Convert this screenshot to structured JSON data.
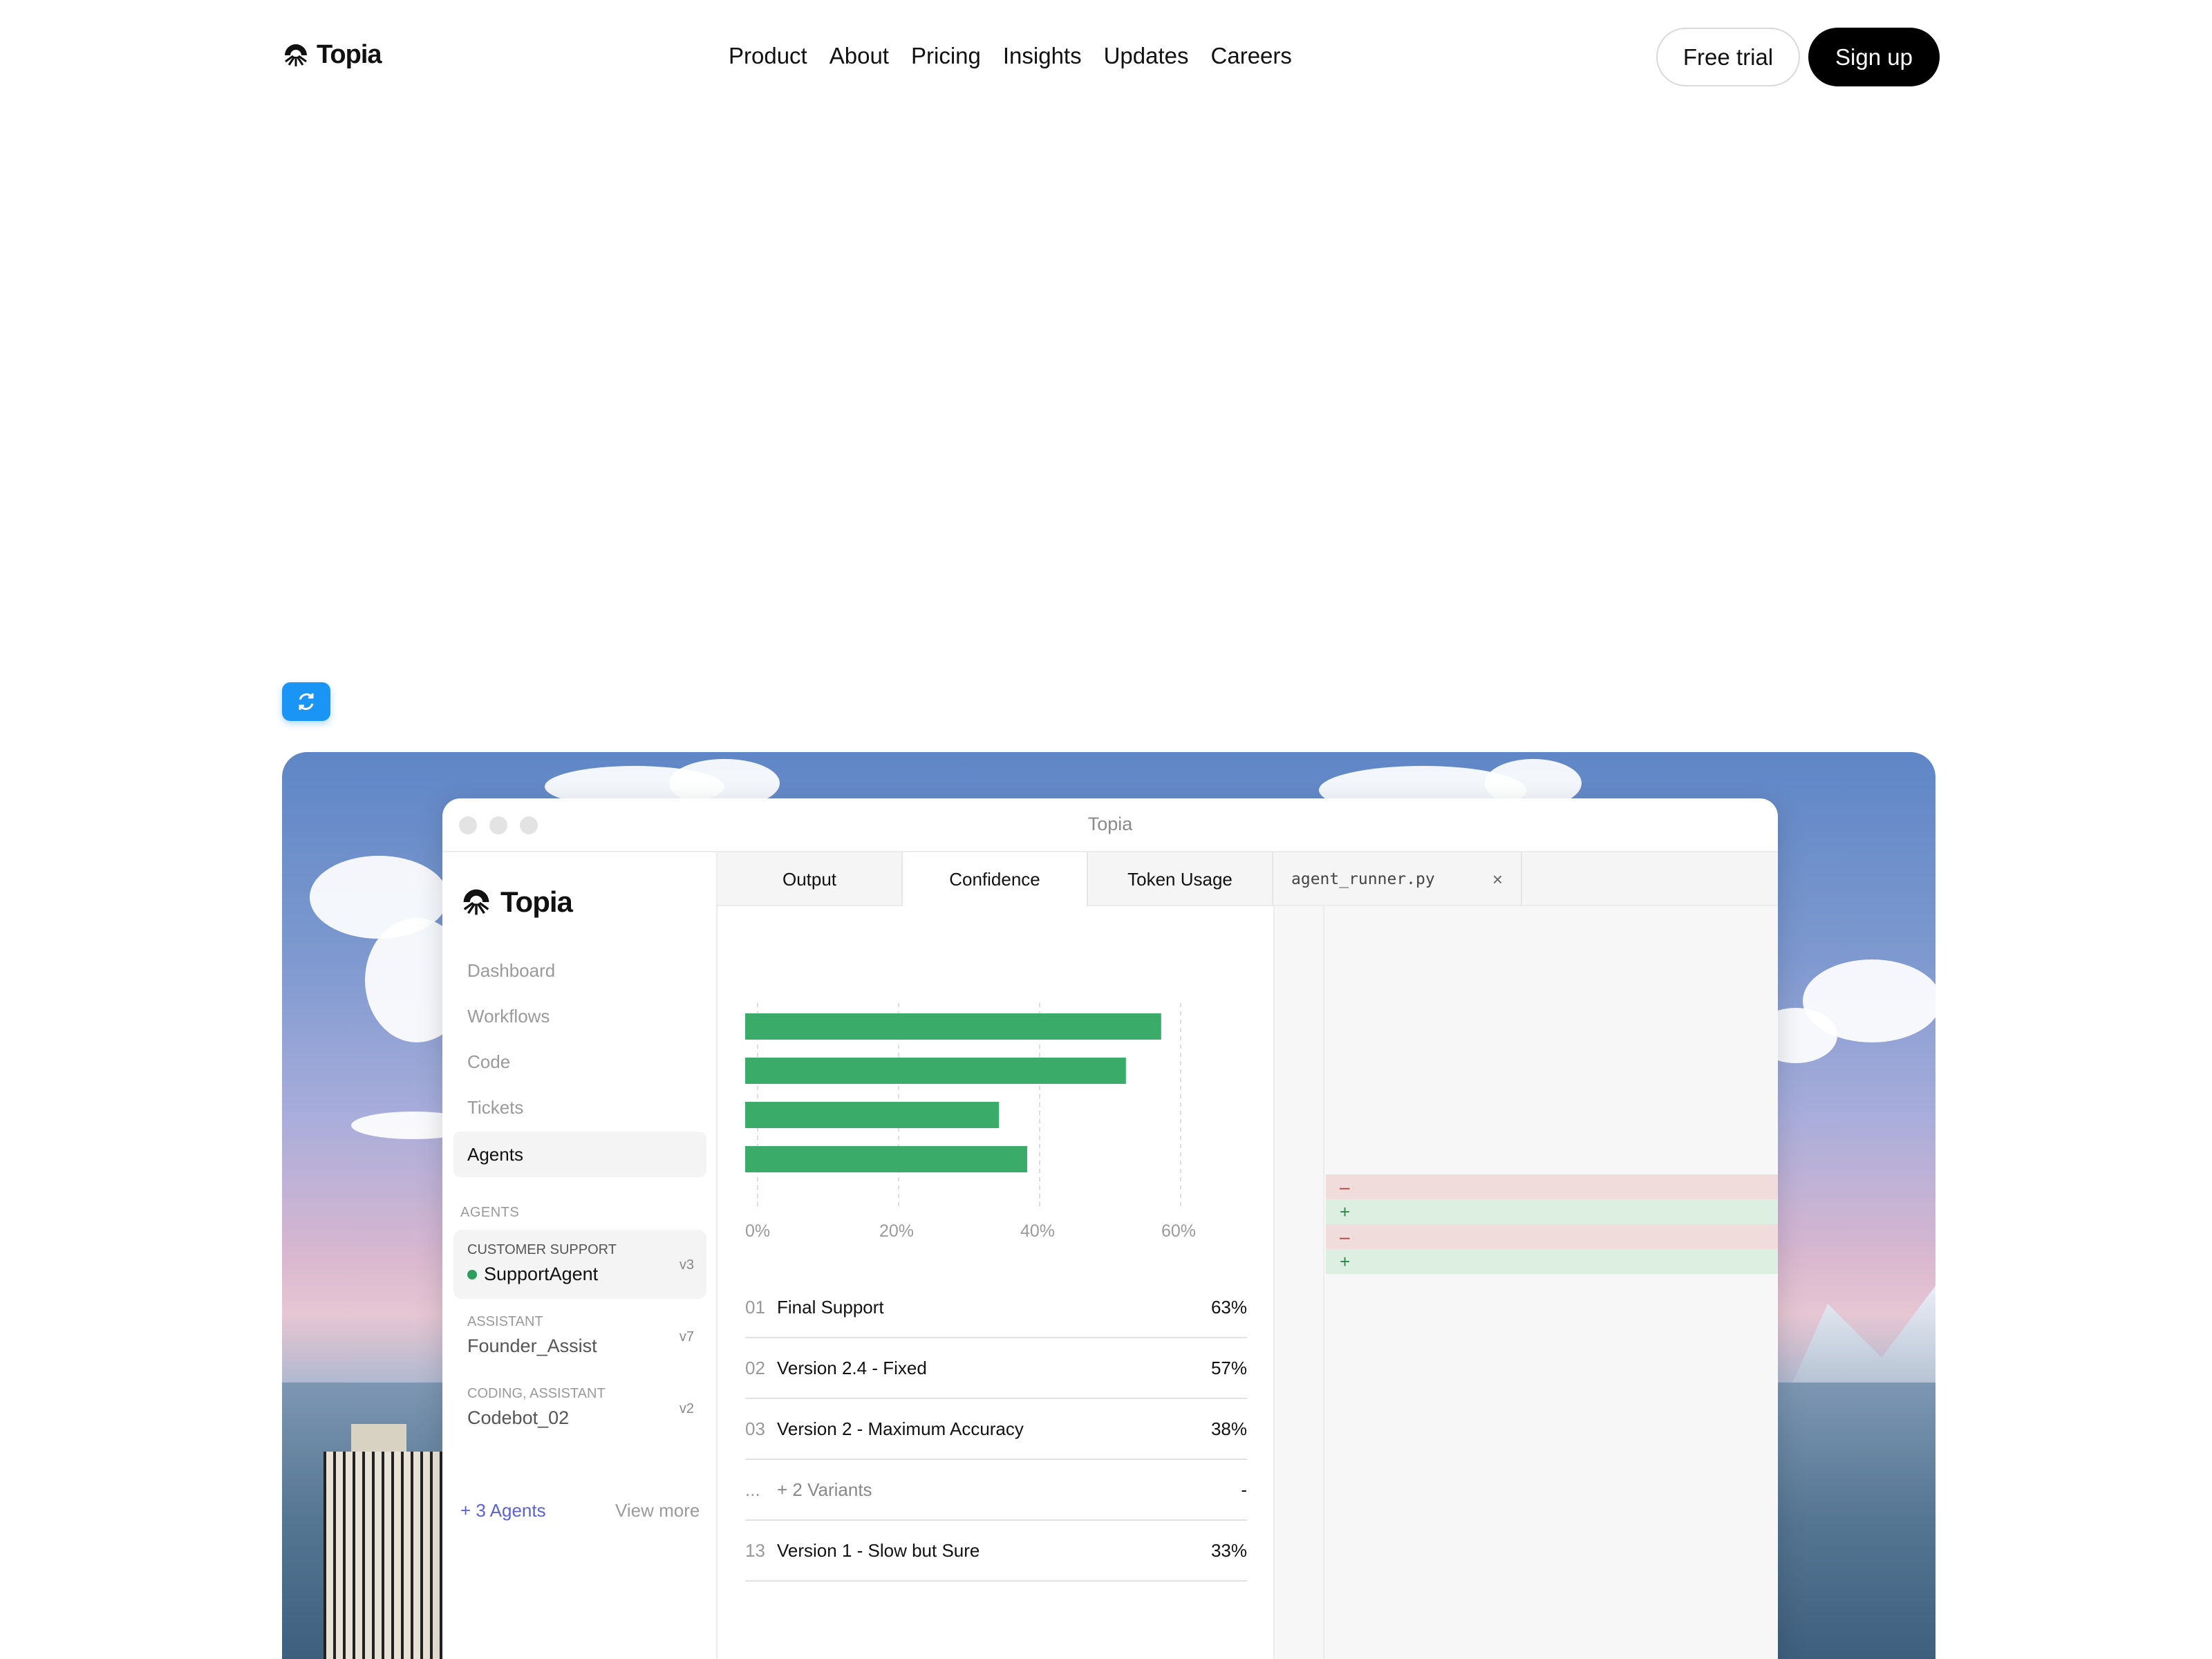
{
  "nav": {
    "brand": "Topia",
    "menu": [
      "Product",
      "About",
      "Pricing",
      "Insights",
      "Updates",
      "Careers"
    ],
    "free_trial": "Free trial",
    "sign_up": "Sign up"
  },
  "window": {
    "title": "Topia",
    "sidebar": {
      "brand": "Topia",
      "items": [
        {
          "label": "Dashboard",
          "active": false
        },
        {
          "label": "Workflows",
          "active": false
        },
        {
          "label": "Code",
          "active": false
        },
        {
          "label": "Tickets",
          "active": false
        },
        {
          "label": "Agents",
          "active": true
        }
      ],
      "section_label": "AGENTS",
      "agents": [
        {
          "category": "CUSTOMER SUPPORT",
          "name": "SupportAgent",
          "version": "v3",
          "active": true
        },
        {
          "category": "ASSISTANT",
          "name": "Founder_Assist",
          "version": "v7",
          "active": false
        },
        {
          "category": "CODING, ASSISTANT",
          "name": "Codebot_02",
          "version": "v2",
          "active": false
        }
      ],
      "more_agents": "+ 3 Agents",
      "view_more": "View more"
    },
    "tabs": [
      {
        "label": "Output",
        "active": false
      },
      {
        "label": "Confidence",
        "active": true
      },
      {
        "label": "Token Usage",
        "active": false
      }
    ],
    "file_tab": {
      "name": "agent_runner.py",
      "close": "×"
    },
    "rows": [
      {
        "idx": "01",
        "label": "Final Support",
        "value": "63%"
      },
      {
        "idx": "02",
        "label": "Version 2.4 - Fixed",
        "value": "57%"
      },
      {
        "idx": "03",
        "label": "Version 2 - Maximum Accuracy",
        "value": "38%"
      },
      {
        "idx": "...",
        "label": "+ 2 Variants",
        "value": "-"
      },
      {
        "idx": "13",
        "label": "Version 1 - Slow but Sure",
        "value": "33%"
      }
    ],
    "diff_lines": [
      {
        "sign": "–",
        "type": "minus"
      },
      {
        "sign": "+",
        "type": "plus"
      },
      {
        "sign": "–",
        "type": "minus"
      },
      {
        "sign": "+",
        "type": "plus"
      }
    ]
  },
  "chart_data": {
    "type": "bar",
    "orientation": "horizontal",
    "values": [
      59,
      54,
      36,
      40
    ],
    "xlim": [
      0,
      60
    ],
    "ticks": [
      "0%",
      "20%",
      "40%",
      "60%"
    ],
    "tick_values": [
      0,
      20,
      40,
      60
    ],
    "bar_color": "#3aab68",
    "grid": true
  },
  "colors": {
    "accent_blue": "#1a95f5",
    "bar_green": "#3aab68",
    "link_purple": "#5a62d8"
  }
}
